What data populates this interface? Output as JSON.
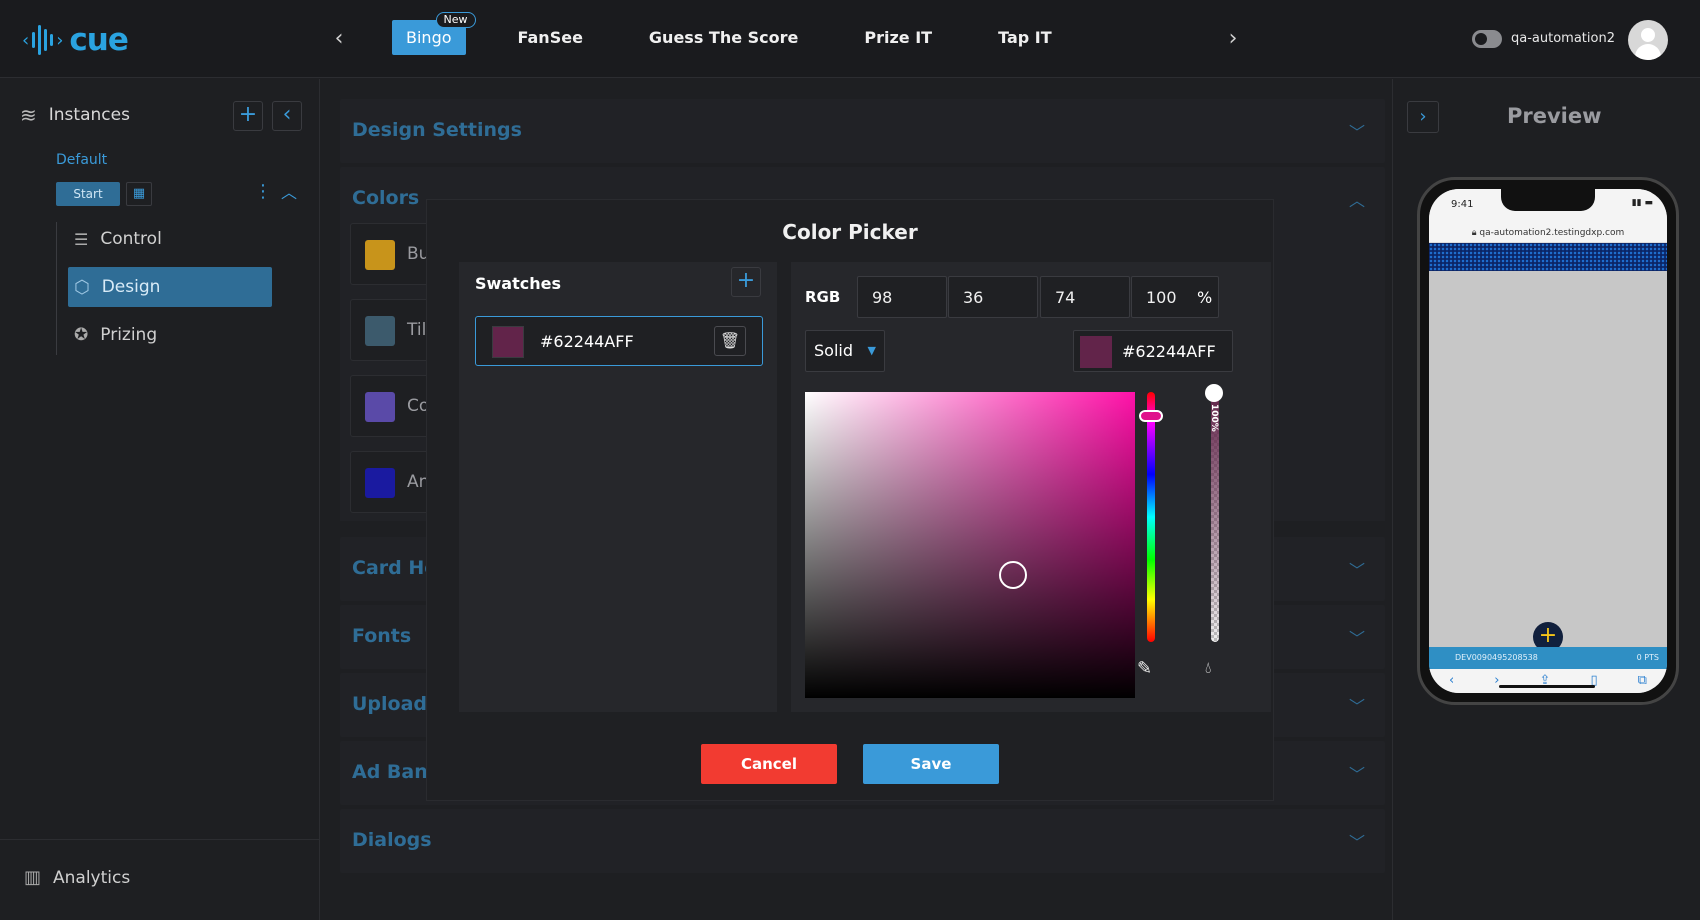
{
  "app": {
    "logo_text": "cue"
  },
  "topnav": {
    "games": [
      {
        "label": "Bingo",
        "badge": "New",
        "active": true
      },
      {
        "label": "FanSee"
      },
      {
        "label": "Guess The Score"
      },
      {
        "label": "Prize IT"
      },
      {
        "label": "Tap IT"
      }
    ],
    "prev_icon": "‹",
    "next_icon": "›",
    "username": "qa-automation2"
  },
  "sidebar": {
    "title": "Instances",
    "add_icon": "+",
    "collapse_icon": "‹",
    "default_label": "Default",
    "start_label": "Start",
    "items": [
      {
        "label": "Control",
        "icon": "sliders-icon"
      },
      {
        "label": "Design",
        "icon": "cube-icon",
        "active": true
      },
      {
        "label": "Prizing",
        "icon": "award-icon"
      }
    ],
    "analytics_label": "Analytics"
  },
  "main": {
    "sections": [
      {
        "title": "Design Settings"
      },
      {
        "title": "Colors"
      },
      {
        "title": "Card He"
      },
      {
        "title": "Fonts"
      },
      {
        "title": "Uploads"
      },
      {
        "title": "Ad Bann"
      },
      {
        "title": "Dialogs"
      }
    ],
    "color_rows": [
      {
        "label": "Bu",
        "color": "#c8941b"
      },
      {
        "label": "Til",
        "color": "#3c5a6c"
      },
      {
        "label": "Co",
        "color": "#5a4aa8"
      },
      {
        "label": "An",
        "color": "#1a1aa0"
      }
    ]
  },
  "preview": {
    "title": "Preview",
    "time": "9:41",
    "url": "qa-automation2.testingdxp.com",
    "bar_id": "DEV0090495208538",
    "bar_pts": "0 PTS"
  },
  "color_picker": {
    "title": "Color Picker",
    "swatches_title": "Swatches",
    "swatch_hex": "#62244AFF",
    "mode_label": "RGB",
    "r": "98",
    "g": "36",
    "b": "74",
    "alpha": "100",
    "pct_symbol": "%",
    "fill_type": "Solid",
    "hex_value": "#62244AFF",
    "alpha_label": "100%",
    "selected_color": "#62244a",
    "cancel_label": "Cancel",
    "save_label": "Save"
  }
}
